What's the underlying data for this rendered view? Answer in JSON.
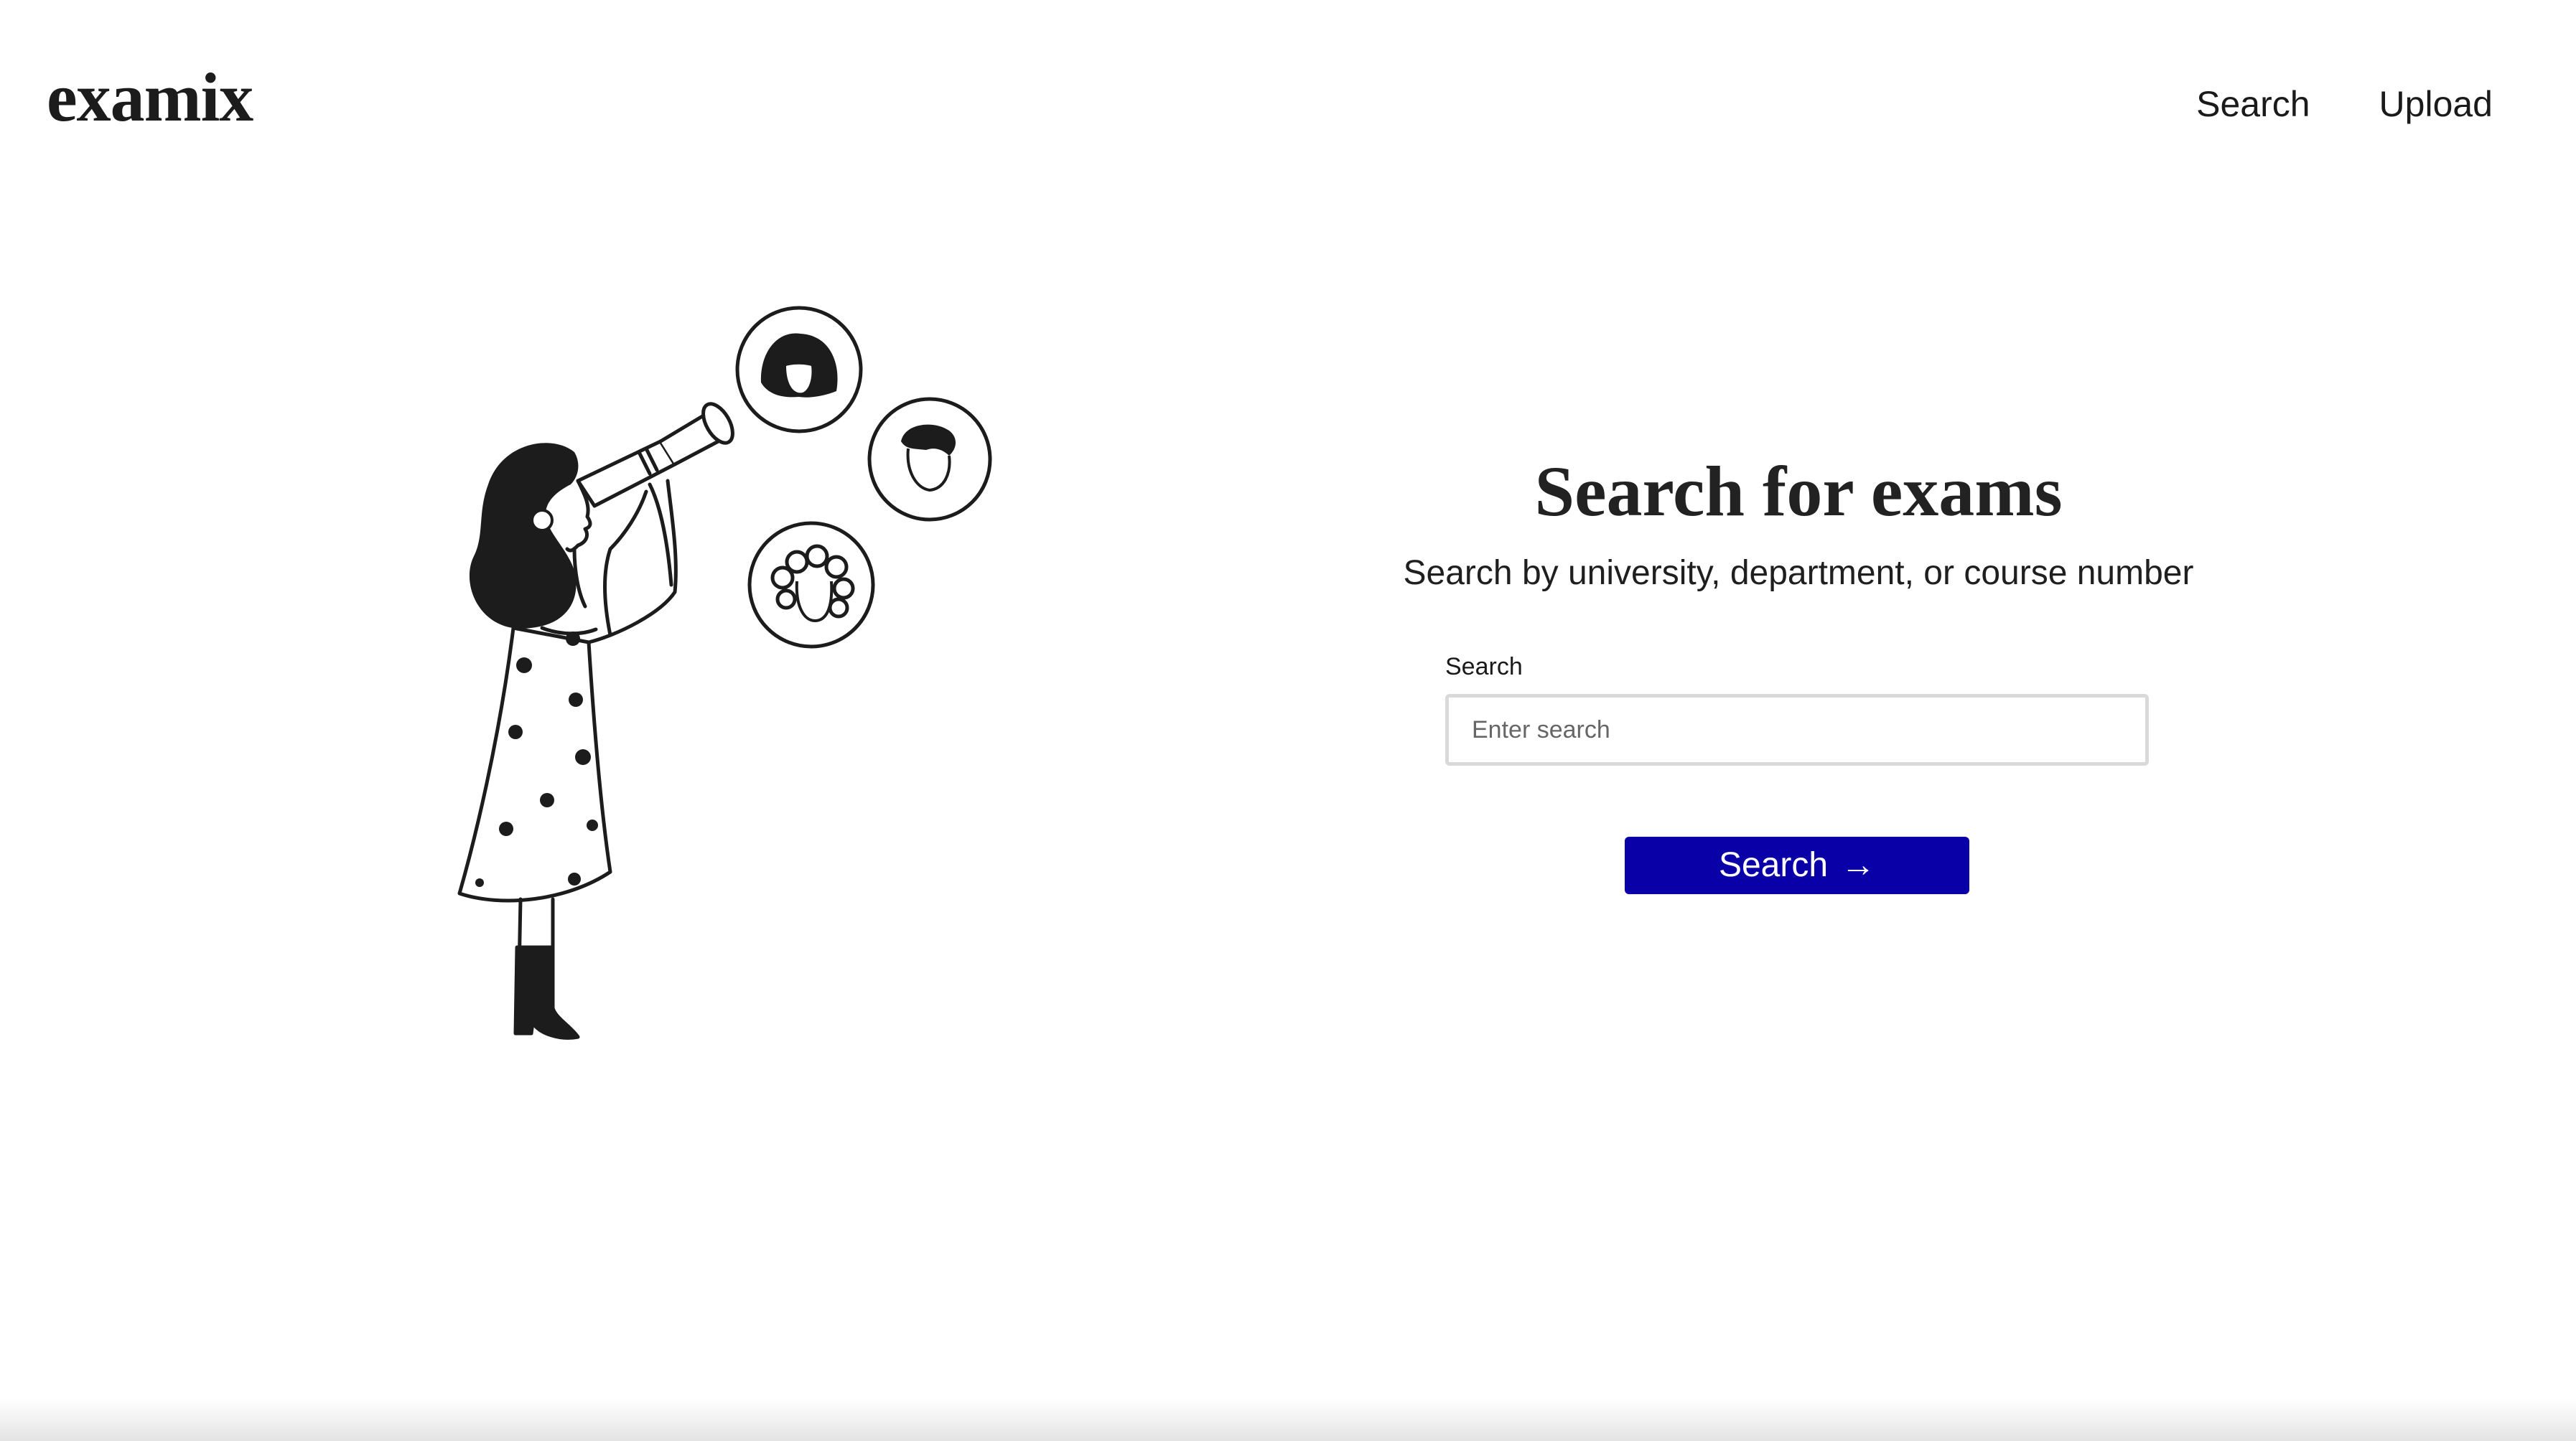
{
  "header": {
    "logo": "examix",
    "nav": [
      {
        "label": "Search"
      },
      {
        "label": "Upload"
      }
    ]
  },
  "main": {
    "title": "Search for exams",
    "subtitle": "Search by university, department, or course number",
    "search": {
      "label": "Search",
      "placeholder": "Enter search",
      "value": ""
    },
    "button": {
      "label": "Search",
      "icon": "arrow-right-icon",
      "color": "#0a00a8"
    }
  },
  "illustration": {
    "subject": "woman-with-telescope-illustration",
    "icons": [
      "woman-face-icon",
      "man-face-icon",
      "curly-hair-face-icon"
    ]
  }
}
